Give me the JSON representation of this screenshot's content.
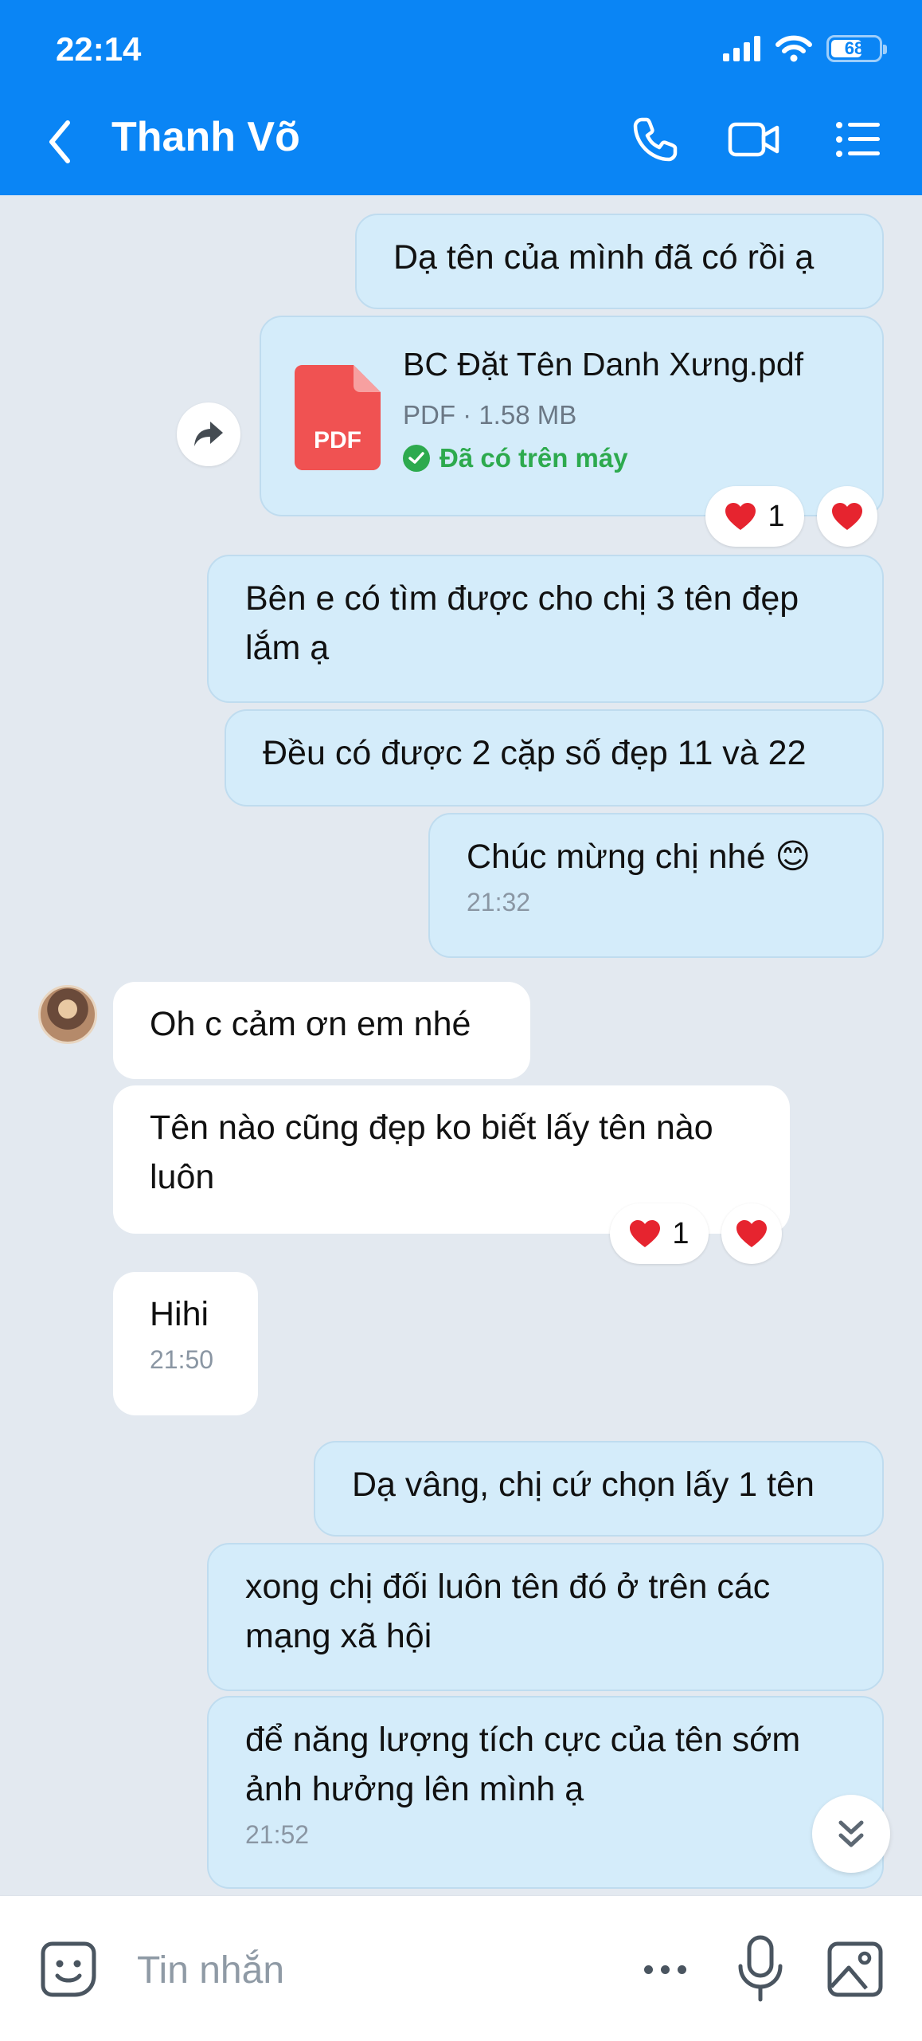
{
  "status_bar": {
    "time": "22:14",
    "battery": "68",
    "battery_level": 0.68
  },
  "header": {
    "contact_name": "Thanh Võ"
  },
  "messages": {
    "m1": {
      "text": "Dạ tên của mình đã có rồi ạ"
    },
    "file": {
      "name": "BC Đặt Tên Danh Xưng.pdf",
      "meta": "PDF · 1.58 MB",
      "status": "Đã có trên máy",
      "icon_label": "PDF",
      "reaction_count": "1"
    },
    "m2": {
      "text": "Bên e có tìm được cho chị 3 tên đẹp lắm ạ"
    },
    "m3": {
      "text": "Đều có được 2 cặp số đẹp 11 và 22"
    },
    "m4": {
      "text": "Chúc mừng chị nhé 😊",
      "time": "21:32"
    },
    "m5": {
      "text": "Oh c cảm ơn em nhé"
    },
    "m6": {
      "text": "Tên nào cũng đẹp ko biết lấy tên nào luôn",
      "reaction_count": "1"
    },
    "m7": {
      "text": "Hihi",
      "time": "21:50"
    },
    "m8": {
      "text": "Dạ vâng, chị cứ chọn lấy 1 tên"
    },
    "m9": {
      "text": "xong chị đối luôn tên đó ở trên các mạng xã hội"
    },
    "m10": {
      "text": "để năng lượng tích cực của tên sớm ảnh hưởng lên mình ạ",
      "time": "21:52"
    }
  },
  "composer": {
    "placeholder": "Tin nhắn"
  },
  "colors": {
    "header": "#0a85f5",
    "outgoing_bubble": "#d4ecfa",
    "incoming_bubble": "#ffffff",
    "background": "#e3e9f0",
    "heart": "#e6242f",
    "pdf": "#f05252",
    "status_ok": "#2daa4e"
  }
}
